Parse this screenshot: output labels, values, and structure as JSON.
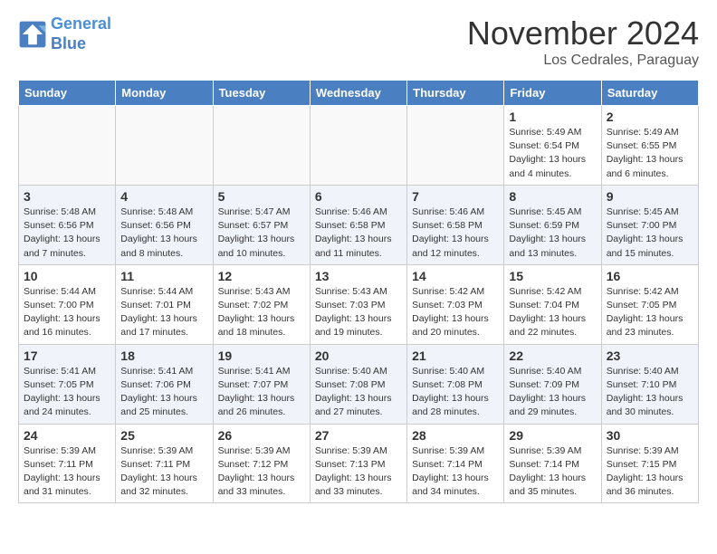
{
  "logo": {
    "line1": "General",
    "line2": "Blue"
  },
  "title": "November 2024",
  "location": "Los Cedrales, Paraguay",
  "days_header": [
    "Sunday",
    "Monday",
    "Tuesday",
    "Wednesday",
    "Thursday",
    "Friday",
    "Saturday"
  ],
  "weeks": [
    [
      {
        "day": "",
        "info": ""
      },
      {
        "day": "",
        "info": ""
      },
      {
        "day": "",
        "info": ""
      },
      {
        "day": "",
        "info": ""
      },
      {
        "day": "",
        "info": ""
      },
      {
        "day": "1",
        "info": "Sunrise: 5:49 AM\nSunset: 6:54 PM\nDaylight: 13 hours and 4 minutes."
      },
      {
        "day": "2",
        "info": "Sunrise: 5:49 AM\nSunset: 6:55 PM\nDaylight: 13 hours and 6 minutes."
      }
    ],
    [
      {
        "day": "3",
        "info": "Sunrise: 5:48 AM\nSunset: 6:56 PM\nDaylight: 13 hours and 7 minutes."
      },
      {
        "day": "4",
        "info": "Sunrise: 5:48 AM\nSunset: 6:56 PM\nDaylight: 13 hours and 8 minutes."
      },
      {
        "day": "5",
        "info": "Sunrise: 5:47 AM\nSunset: 6:57 PM\nDaylight: 13 hours and 10 minutes."
      },
      {
        "day": "6",
        "info": "Sunrise: 5:46 AM\nSunset: 6:58 PM\nDaylight: 13 hours and 11 minutes."
      },
      {
        "day": "7",
        "info": "Sunrise: 5:46 AM\nSunset: 6:58 PM\nDaylight: 13 hours and 12 minutes."
      },
      {
        "day": "8",
        "info": "Sunrise: 5:45 AM\nSunset: 6:59 PM\nDaylight: 13 hours and 13 minutes."
      },
      {
        "day": "9",
        "info": "Sunrise: 5:45 AM\nSunset: 7:00 PM\nDaylight: 13 hours and 15 minutes."
      }
    ],
    [
      {
        "day": "10",
        "info": "Sunrise: 5:44 AM\nSunset: 7:00 PM\nDaylight: 13 hours and 16 minutes."
      },
      {
        "day": "11",
        "info": "Sunrise: 5:44 AM\nSunset: 7:01 PM\nDaylight: 13 hours and 17 minutes."
      },
      {
        "day": "12",
        "info": "Sunrise: 5:43 AM\nSunset: 7:02 PM\nDaylight: 13 hours and 18 minutes."
      },
      {
        "day": "13",
        "info": "Sunrise: 5:43 AM\nSunset: 7:03 PM\nDaylight: 13 hours and 19 minutes."
      },
      {
        "day": "14",
        "info": "Sunrise: 5:42 AM\nSunset: 7:03 PM\nDaylight: 13 hours and 20 minutes."
      },
      {
        "day": "15",
        "info": "Sunrise: 5:42 AM\nSunset: 7:04 PM\nDaylight: 13 hours and 22 minutes."
      },
      {
        "day": "16",
        "info": "Sunrise: 5:42 AM\nSunset: 7:05 PM\nDaylight: 13 hours and 23 minutes."
      }
    ],
    [
      {
        "day": "17",
        "info": "Sunrise: 5:41 AM\nSunset: 7:05 PM\nDaylight: 13 hours and 24 minutes."
      },
      {
        "day": "18",
        "info": "Sunrise: 5:41 AM\nSunset: 7:06 PM\nDaylight: 13 hours and 25 minutes."
      },
      {
        "day": "19",
        "info": "Sunrise: 5:41 AM\nSunset: 7:07 PM\nDaylight: 13 hours and 26 minutes."
      },
      {
        "day": "20",
        "info": "Sunrise: 5:40 AM\nSunset: 7:08 PM\nDaylight: 13 hours and 27 minutes."
      },
      {
        "day": "21",
        "info": "Sunrise: 5:40 AM\nSunset: 7:08 PM\nDaylight: 13 hours and 28 minutes."
      },
      {
        "day": "22",
        "info": "Sunrise: 5:40 AM\nSunset: 7:09 PM\nDaylight: 13 hours and 29 minutes."
      },
      {
        "day": "23",
        "info": "Sunrise: 5:40 AM\nSunset: 7:10 PM\nDaylight: 13 hours and 30 minutes."
      }
    ],
    [
      {
        "day": "24",
        "info": "Sunrise: 5:39 AM\nSunset: 7:11 PM\nDaylight: 13 hours and 31 minutes."
      },
      {
        "day": "25",
        "info": "Sunrise: 5:39 AM\nSunset: 7:11 PM\nDaylight: 13 hours and 32 minutes."
      },
      {
        "day": "26",
        "info": "Sunrise: 5:39 AM\nSunset: 7:12 PM\nDaylight: 13 hours and 33 minutes."
      },
      {
        "day": "27",
        "info": "Sunrise: 5:39 AM\nSunset: 7:13 PM\nDaylight: 13 hours and 33 minutes."
      },
      {
        "day": "28",
        "info": "Sunrise: 5:39 AM\nSunset: 7:14 PM\nDaylight: 13 hours and 34 minutes."
      },
      {
        "day": "29",
        "info": "Sunrise: 5:39 AM\nSunset: 7:14 PM\nDaylight: 13 hours and 35 minutes."
      },
      {
        "day": "30",
        "info": "Sunrise: 5:39 AM\nSunset: 7:15 PM\nDaylight: 13 hours and 36 minutes."
      }
    ]
  ]
}
